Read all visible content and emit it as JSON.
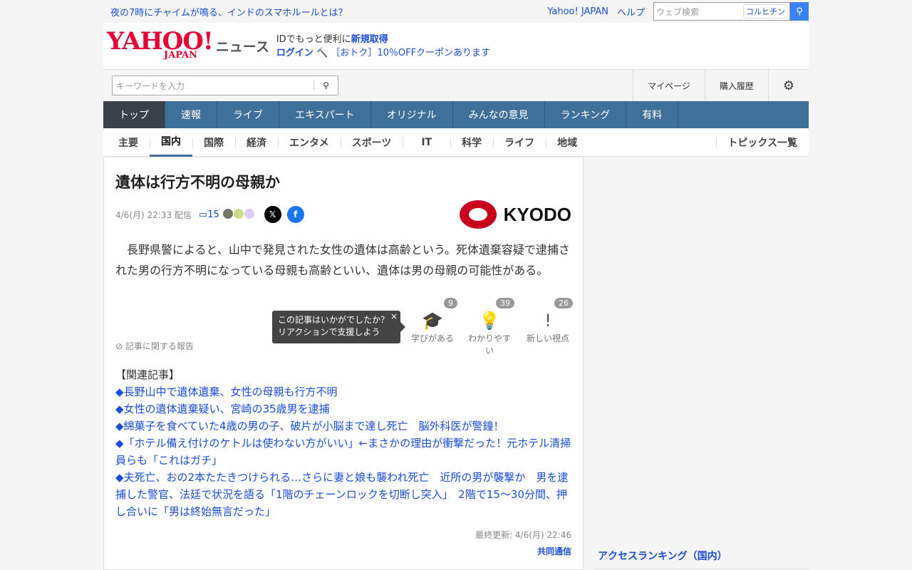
{
  "topbar": {
    "headline": "夜の7時にチャイムが鳴る、インドのスマホルールとは？",
    "yahoo_link": "Yahoo! JAPAN",
    "help": "ヘルプ",
    "search_placeholder": "ウェブ検索",
    "kb_label": "コルヒチン"
  },
  "header": {
    "logo": "YAHOO!",
    "logo_sub": "JAPAN",
    "service": "ニュース",
    "id_text": "IDでもっと便利に",
    "signup": "新規取得",
    "login": "ログイン",
    "coupon": "［おトク］10％OFFクーポンあります"
  },
  "search": {
    "placeholder": "キーワードを入力",
    "mypage": "マイページ",
    "history": "購入履歴"
  },
  "nav": [
    "トップ",
    "速報",
    "ライブ",
    "エキスパート",
    "オリジナル",
    "みんなの意見",
    "ランキング",
    "有料"
  ],
  "subnav": [
    "主要",
    "国内",
    "国際",
    "経済",
    "エンタメ",
    "スポーツ",
    "IT",
    "科学",
    "ライフ",
    "地域"
  ],
  "topics_all": "トピックス一覧",
  "article": {
    "title": "遺体は行方不明の母親か",
    "date": "4/6(月) 22:33 配信",
    "comments": "15",
    "source_logo": "KYODO",
    "body": "　長野県警によると、山中で発見された女性の遺体は高齢という。死体遺棄容疑で逮捕された男の行方不明になっている母親も高齢といい、遺体は男の母親の可能性がある。",
    "report": "記事に関する報告",
    "tooltip_line1": "この記事はいかがでしたか？",
    "tooltip_line2": "リアクションで支援しよう",
    "reactions": [
      {
        "label": "学びがある",
        "count": "9"
      },
      {
        "label": "わかりやすい",
        "count": "39"
      },
      {
        "label": "新しい視点",
        "count": "26"
      }
    ],
    "related_heading": "【関連記事】",
    "related": [
      "◆長野山中で遺体遺棄、女性の母親も行方不明",
      "◆女性の遺体遺棄疑い、宮崎の35歳男を逮捕",
      "◆綿菓子を食べていた4歳の男の子、破片が小脳まで達し死亡　脳外科医が警鐘！",
      "◆「ホテル備え付けのケトルは使わない方がいい」←まさかの理由が衝撃だった！元ホテル清掃員らも「これはガチ」",
      "◆夫死亡、おの2本たたきつけられる…さらに妻と娘も襲われ死亡　近所の男が襲撃か　男を逮捕した警官、法廷で状況を語る「1階のチェーンロックを切断し突入」　2階で15～30分間、押し合いに「男は終始無言だった」"
    ],
    "updated": "最終更新: 4/6(月) 22:46",
    "source": "共同通信"
  },
  "sidebar": {
    "ranking_title": "アクセスランキング（国内）"
  }
}
